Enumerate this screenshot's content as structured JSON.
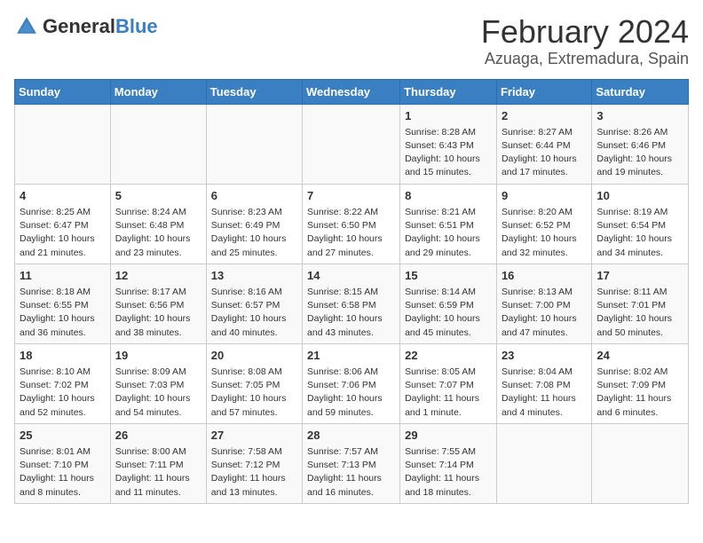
{
  "header": {
    "logo_general": "General",
    "logo_blue": "Blue",
    "month_title": "February 2024",
    "location": "Azuaga, Extremadura, Spain"
  },
  "days_of_week": [
    "Sunday",
    "Monday",
    "Tuesday",
    "Wednesday",
    "Thursday",
    "Friday",
    "Saturday"
  ],
  "weeks": [
    [
      {
        "day": "",
        "info": ""
      },
      {
        "day": "",
        "info": ""
      },
      {
        "day": "",
        "info": ""
      },
      {
        "day": "",
        "info": ""
      },
      {
        "day": "1",
        "info": "Sunrise: 8:28 AM\nSunset: 6:43 PM\nDaylight: 10 hours\nand 15 minutes."
      },
      {
        "day": "2",
        "info": "Sunrise: 8:27 AM\nSunset: 6:44 PM\nDaylight: 10 hours\nand 17 minutes."
      },
      {
        "day": "3",
        "info": "Sunrise: 8:26 AM\nSunset: 6:46 PM\nDaylight: 10 hours\nand 19 minutes."
      }
    ],
    [
      {
        "day": "4",
        "info": "Sunrise: 8:25 AM\nSunset: 6:47 PM\nDaylight: 10 hours\nand 21 minutes."
      },
      {
        "day": "5",
        "info": "Sunrise: 8:24 AM\nSunset: 6:48 PM\nDaylight: 10 hours\nand 23 minutes."
      },
      {
        "day": "6",
        "info": "Sunrise: 8:23 AM\nSunset: 6:49 PM\nDaylight: 10 hours\nand 25 minutes."
      },
      {
        "day": "7",
        "info": "Sunrise: 8:22 AM\nSunset: 6:50 PM\nDaylight: 10 hours\nand 27 minutes."
      },
      {
        "day": "8",
        "info": "Sunrise: 8:21 AM\nSunset: 6:51 PM\nDaylight: 10 hours\nand 29 minutes."
      },
      {
        "day": "9",
        "info": "Sunrise: 8:20 AM\nSunset: 6:52 PM\nDaylight: 10 hours\nand 32 minutes."
      },
      {
        "day": "10",
        "info": "Sunrise: 8:19 AM\nSunset: 6:54 PM\nDaylight: 10 hours\nand 34 minutes."
      }
    ],
    [
      {
        "day": "11",
        "info": "Sunrise: 8:18 AM\nSunset: 6:55 PM\nDaylight: 10 hours\nand 36 minutes."
      },
      {
        "day": "12",
        "info": "Sunrise: 8:17 AM\nSunset: 6:56 PM\nDaylight: 10 hours\nand 38 minutes."
      },
      {
        "day": "13",
        "info": "Sunrise: 8:16 AM\nSunset: 6:57 PM\nDaylight: 10 hours\nand 40 minutes."
      },
      {
        "day": "14",
        "info": "Sunrise: 8:15 AM\nSunset: 6:58 PM\nDaylight: 10 hours\nand 43 minutes."
      },
      {
        "day": "15",
        "info": "Sunrise: 8:14 AM\nSunset: 6:59 PM\nDaylight: 10 hours\nand 45 minutes."
      },
      {
        "day": "16",
        "info": "Sunrise: 8:13 AM\nSunset: 7:00 PM\nDaylight: 10 hours\nand 47 minutes."
      },
      {
        "day": "17",
        "info": "Sunrise: 8:11 AM\nSunset: 7:01 PM\nDaylight: 10 hours\nand 50 minutes."
      }
    ],
    [
      {
        "day": "18",
        "info": "Sunrise: 8:10 AM\nSunset: 7:02 PM\nDaylight: 10 hours\nand 52 minutes."
      },
      {
        "day": "19",
        "info": "Sunrise: 8:09 AM\nSunset: 7:03 PM\nDaylight: 10 hours\nand 54 minutes."
      },
      {
        "day": "20",
        "info": "Sunrise: 8:08 AM\nSunset: 7:05 PM\nDaylight: 10 hours\nand 57 minutes."
      },
      {
        "day": "21",
        "info": "Sunrise: 8:06 AM\nSunset: 7:06 PM\nDaylight: 10 hours\nand 59 minutes."
      },
      {
        "day": "22",
        "info": "Sunrise: 8:05 AM\nSunset: 7:07 PM\nDaylight: 11 hours\nand 1 minute."
      },
      {
        "day": "23",
        "info": "Sunrise: 8:04 AM\nSunset: 7:08 PM\nDaylight: 11 hours\nand 4 minutes."
      },
      {
        "day": "24",
        "info": "Sunrise: 8:02 AM\nSunset: 7:09 PM\nDaylight: 11 hours\nand 6 minutes."
      }
    ],
    [
      {
        "day": "25",
        "info": "Sunrise: 8:01 AM\nSunset: 7:10 PM\nDaylight: 11 hours\nand 8 minutes."
      },
      {
        "day": "26",
        "info": "Sunrise: 8:00 AM\nSunset: 7:11 PM\nDaylight: 11 hours\nand 11 minutes."
      },
      {
        "day": "27",
        "info": "Sunrise: 7:58 AM\nSunset: 7:12 PM\nDaylight: 11 hours\nand 13 minutes."
      },
      {
        "day": "28",
        "info": "Sunrise: 7:57 AM\nSunset: 7:13 PM\nDaylight: 11 hours\nand 16 minutes."
      },
      {
        "day": "29",
        "info": "Sunrise: 7:55 AM\nSunset: 7:14 PM\nDaylight: 11 hours\nand 18 minutes."
      },
      {
        "day": "",
        "info": ""
      },
      {
        "day": "",
        "info": ""
      }
    ]
  ]
}
